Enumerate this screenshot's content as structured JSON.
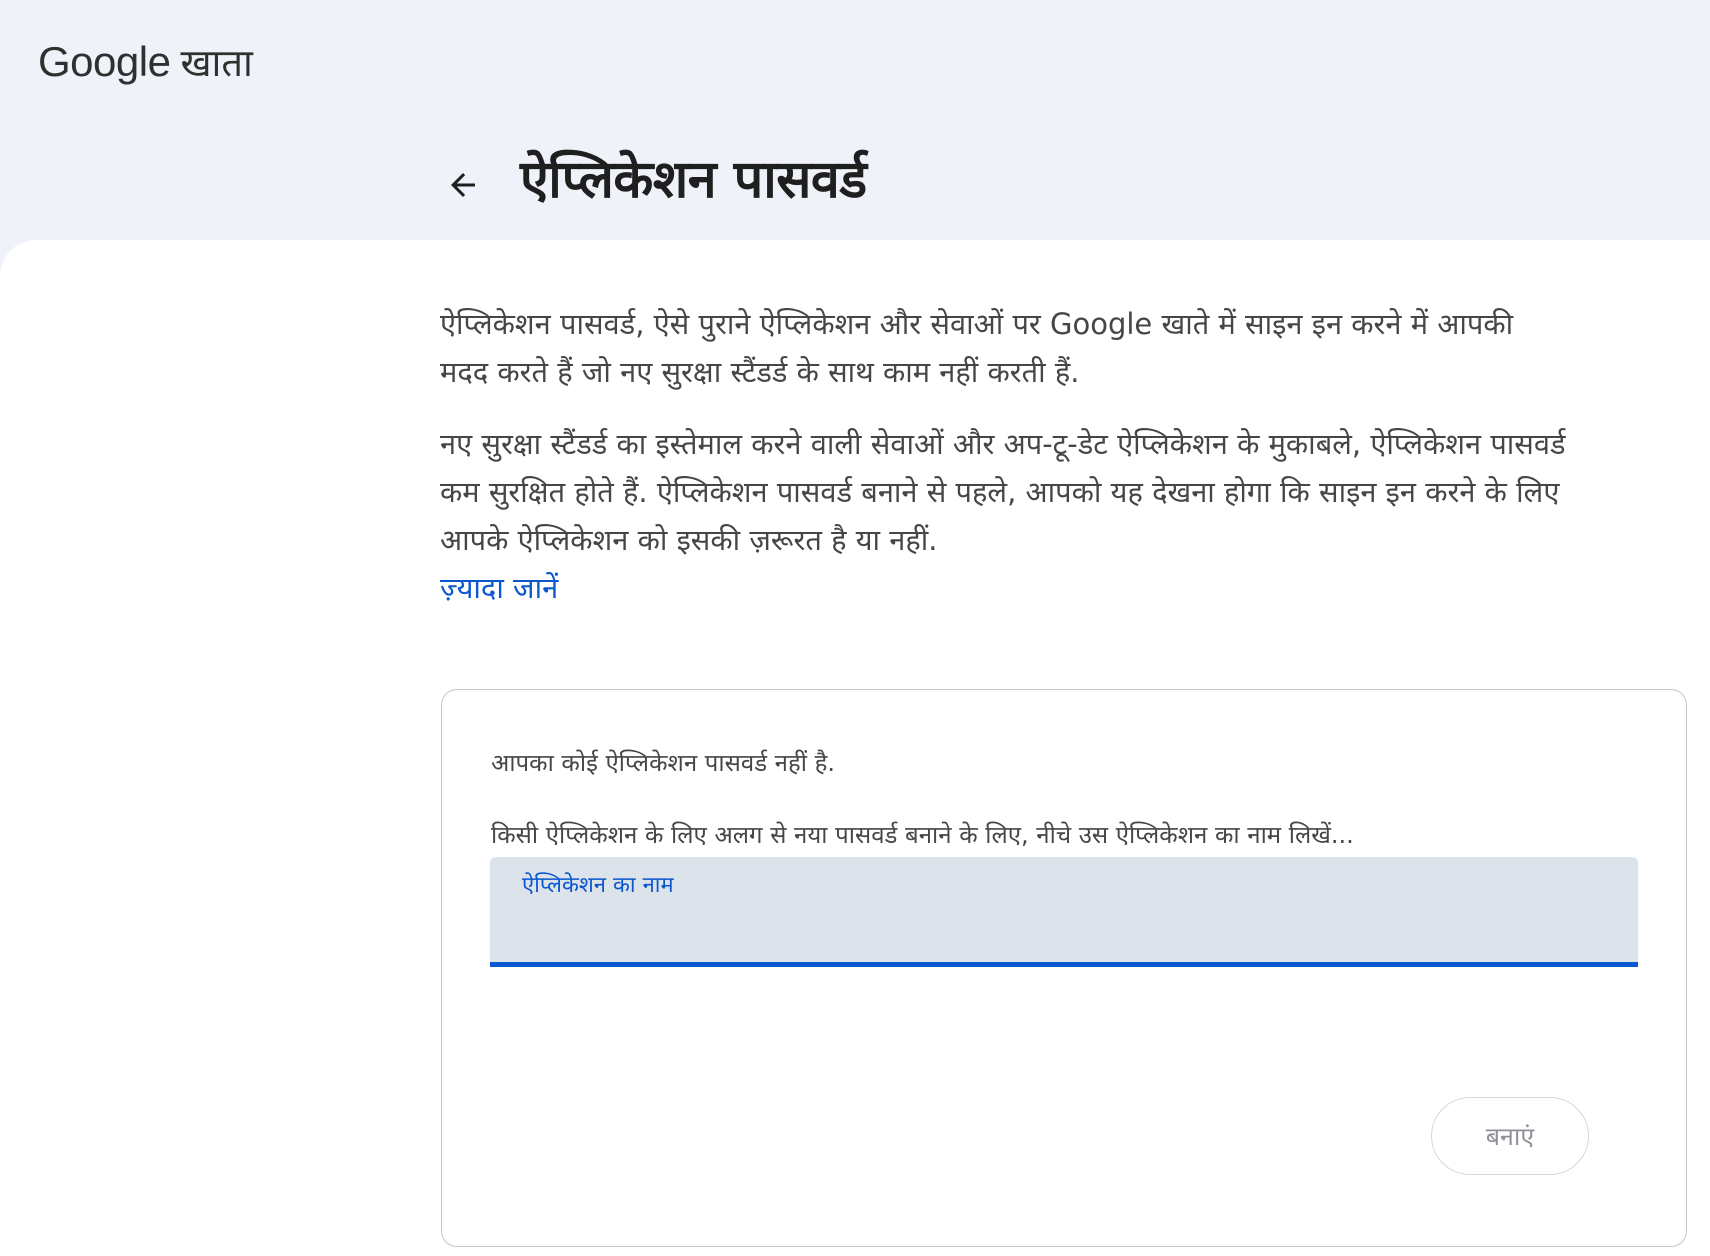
{
  "header": {
    "brand_google": "Google",
    "brand_account": "खाता",
    "back_icon": "arrow-back-icon",
    "title": "ऐप्लिकेशन पासवर्ड"
  },
  "intro": {
    "paragraph1": "ऐप्लिकेशन पासवर्ड, ऐसे पुराने ऐप्लिकेशन और सेवाओं पर Google खाते में साइन इन करने में आपकी मदद करते हैं जो नए सुरक्षा स्टैंडर्ड के साथ काम नहीं करती हैं.",
    "paragraph2": "नए सुरक्षा स्टैंडर्ड का इस्तेमाल करने वाली सेवाओं और अप-टू-डेट ऐप्लिकेशन के मुकाबले, ऐप्लिकेशन पासवर्ड कम सुरक्षित होते हैं. ऐप्लिकेशन पासवर्ड बनाने से पहले, आपको यह देखना होगा कि साइन इन करने के लिए आपके ऐप्लिकेशन को इसकी ज़रूरत है या नहीं.",
    "learn_more": "ज़्यादा जानें"
  },
  "card": {
    "empty_message": "आपका कोई ऐप्लिकेशन पासवर्ड नहीं है.",
    "instruction": "किसी ऐप्लिकेशन के लिए अलग से नया पासवर्ड बनाने के लिए, नीचे उस ऐप्लिकेशन का नाम लिखें...",
    "field_label": "ऐप्लिकेशन का नाम",
    "field_value": "",
    "create_label": "बनाएं",
    "create_enabled": false
  },
  "colors": {
    "header_bg": "#eff2f8",
    "accent": "#0b57d0",
    "field_bg": "#dde3ea",
    "body_text": "#444746",
    "disabled_text": "#8e9196"
  }
}
